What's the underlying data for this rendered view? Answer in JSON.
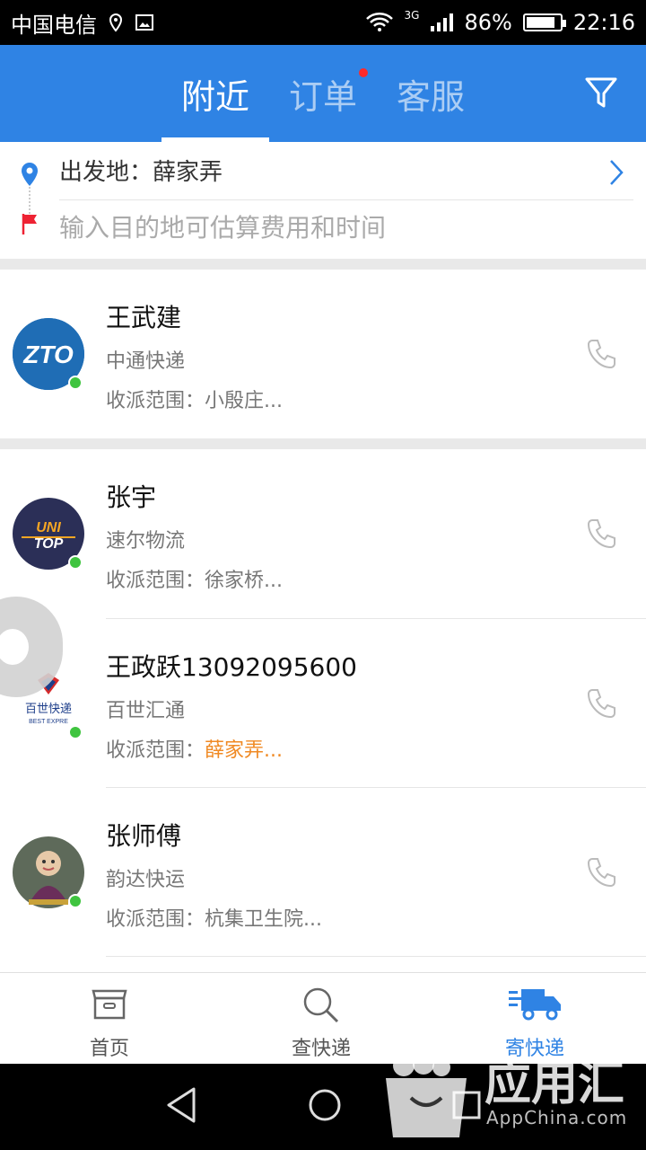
{
  "status_bar": {
    "carrier": "中国电信",
    "network": "3G",
    "battery": "86%",
    "battery_level": 0.86,
    "time": "22:16"
  },
  "header": {
    "tabs": [
      {
        "label": "附近",
        "active": true
      },
      {
        "label": "订单",
        "badge": true
      },
      {
        "label": "客服"
      }
    ],
    "filter_icon": "filter-icon"
  },
  "route": {
    "start_label": "出发地：薛家弄",
    "destination_placeholder": "输入目的地可估算费用和时间"
  },
  "couriers": [
    {
      "name": "王武建",
      "company": "中通快递",
      "range_prefix": "收派范围：",
      "range_value": "小殷庄...",
      "highlight": false,
      "logo": "ZTO"
    },
    {
      "name": "张宇",
      "company": "速尔物流",
      "range_prefix": "收派范围：",
      "range_value": "徐家桥...",
      "highlight": false,
      "logo": "UNI TOP"
    },
    {
      "name": "王政跃13092095600",
      "company": "百世汇通",
      "range_prefix": "收派范围：",
      "range_value": "薛家弄...",
      "highlight": true,
      "logo": "百世快递",
      "logo_sub": "BEST EXPRE"
    },
    {
      "name": "张师傅",
      "company": "韵达快运",
      "range_prefix": "收派范围：",
      "range_value": "杭集卫生院...",
      "highlight": false,
      "logo": ""
    }
  ],
  "bottom_nav": [
    {
      "label": "首页",
      "icon": "box-icon"
    },
    {
      "label": "查快递",
      "icon": "search-icon"
    },
    {
      "label": "寄快递",
      "icon": "truck-icon",
      "active": true
    }
  ],
  "watermark": {
    "text": "应用汇",
    "sub": "AppChina.com"
  },
  "colors": {
    "brand": "#2f83e4",
    "online": "#3fc43f",
    "highlight": "#f08a24",
    "badge": "#ff2a2a"
  }
}
